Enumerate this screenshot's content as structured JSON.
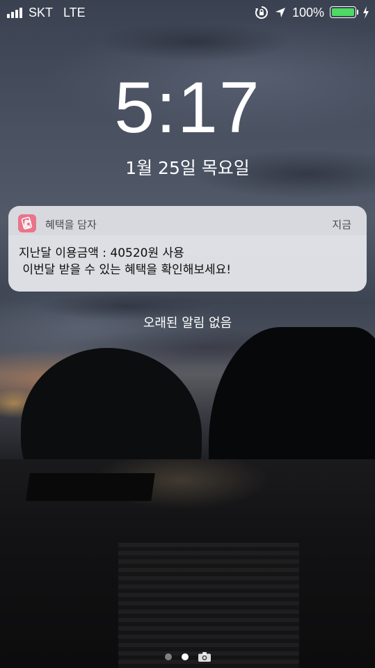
{
  "status_bar": {
    "carrier": "SKT",
    "network": "LTE",
    "battery_percent": "100%",
    "battery_level": 1.0,
    "battery_color": "#4cd964",
    "icons": [
      "signal-icon",
      "orientation-lock-icon",
      "location-arrow-icon",
      "battery-icon",
      "charging-bolt-icon"
    ]
  },
  "lock_screen": {
    "time": "5:17",
    "date": "1월 25일 목요일"
  },
  "notification": {
    "app_icon": "wallet-app-icon",
    "app_icon_color": "#e8758a",
    "app_name": "혜택을 담자",
    "time": "지금",
    "message": "지난달 이용금액 : 40520원 사용\n 이번달 받을 수 있는 혜택을 확인해보세요!"
  },
  "no_older_notifications": "오래된 알림 없음",
  "page_indicator": {
    "pages": 2,
    "active": 1,
    "extra_icon": "camera-icon"
  }
}
